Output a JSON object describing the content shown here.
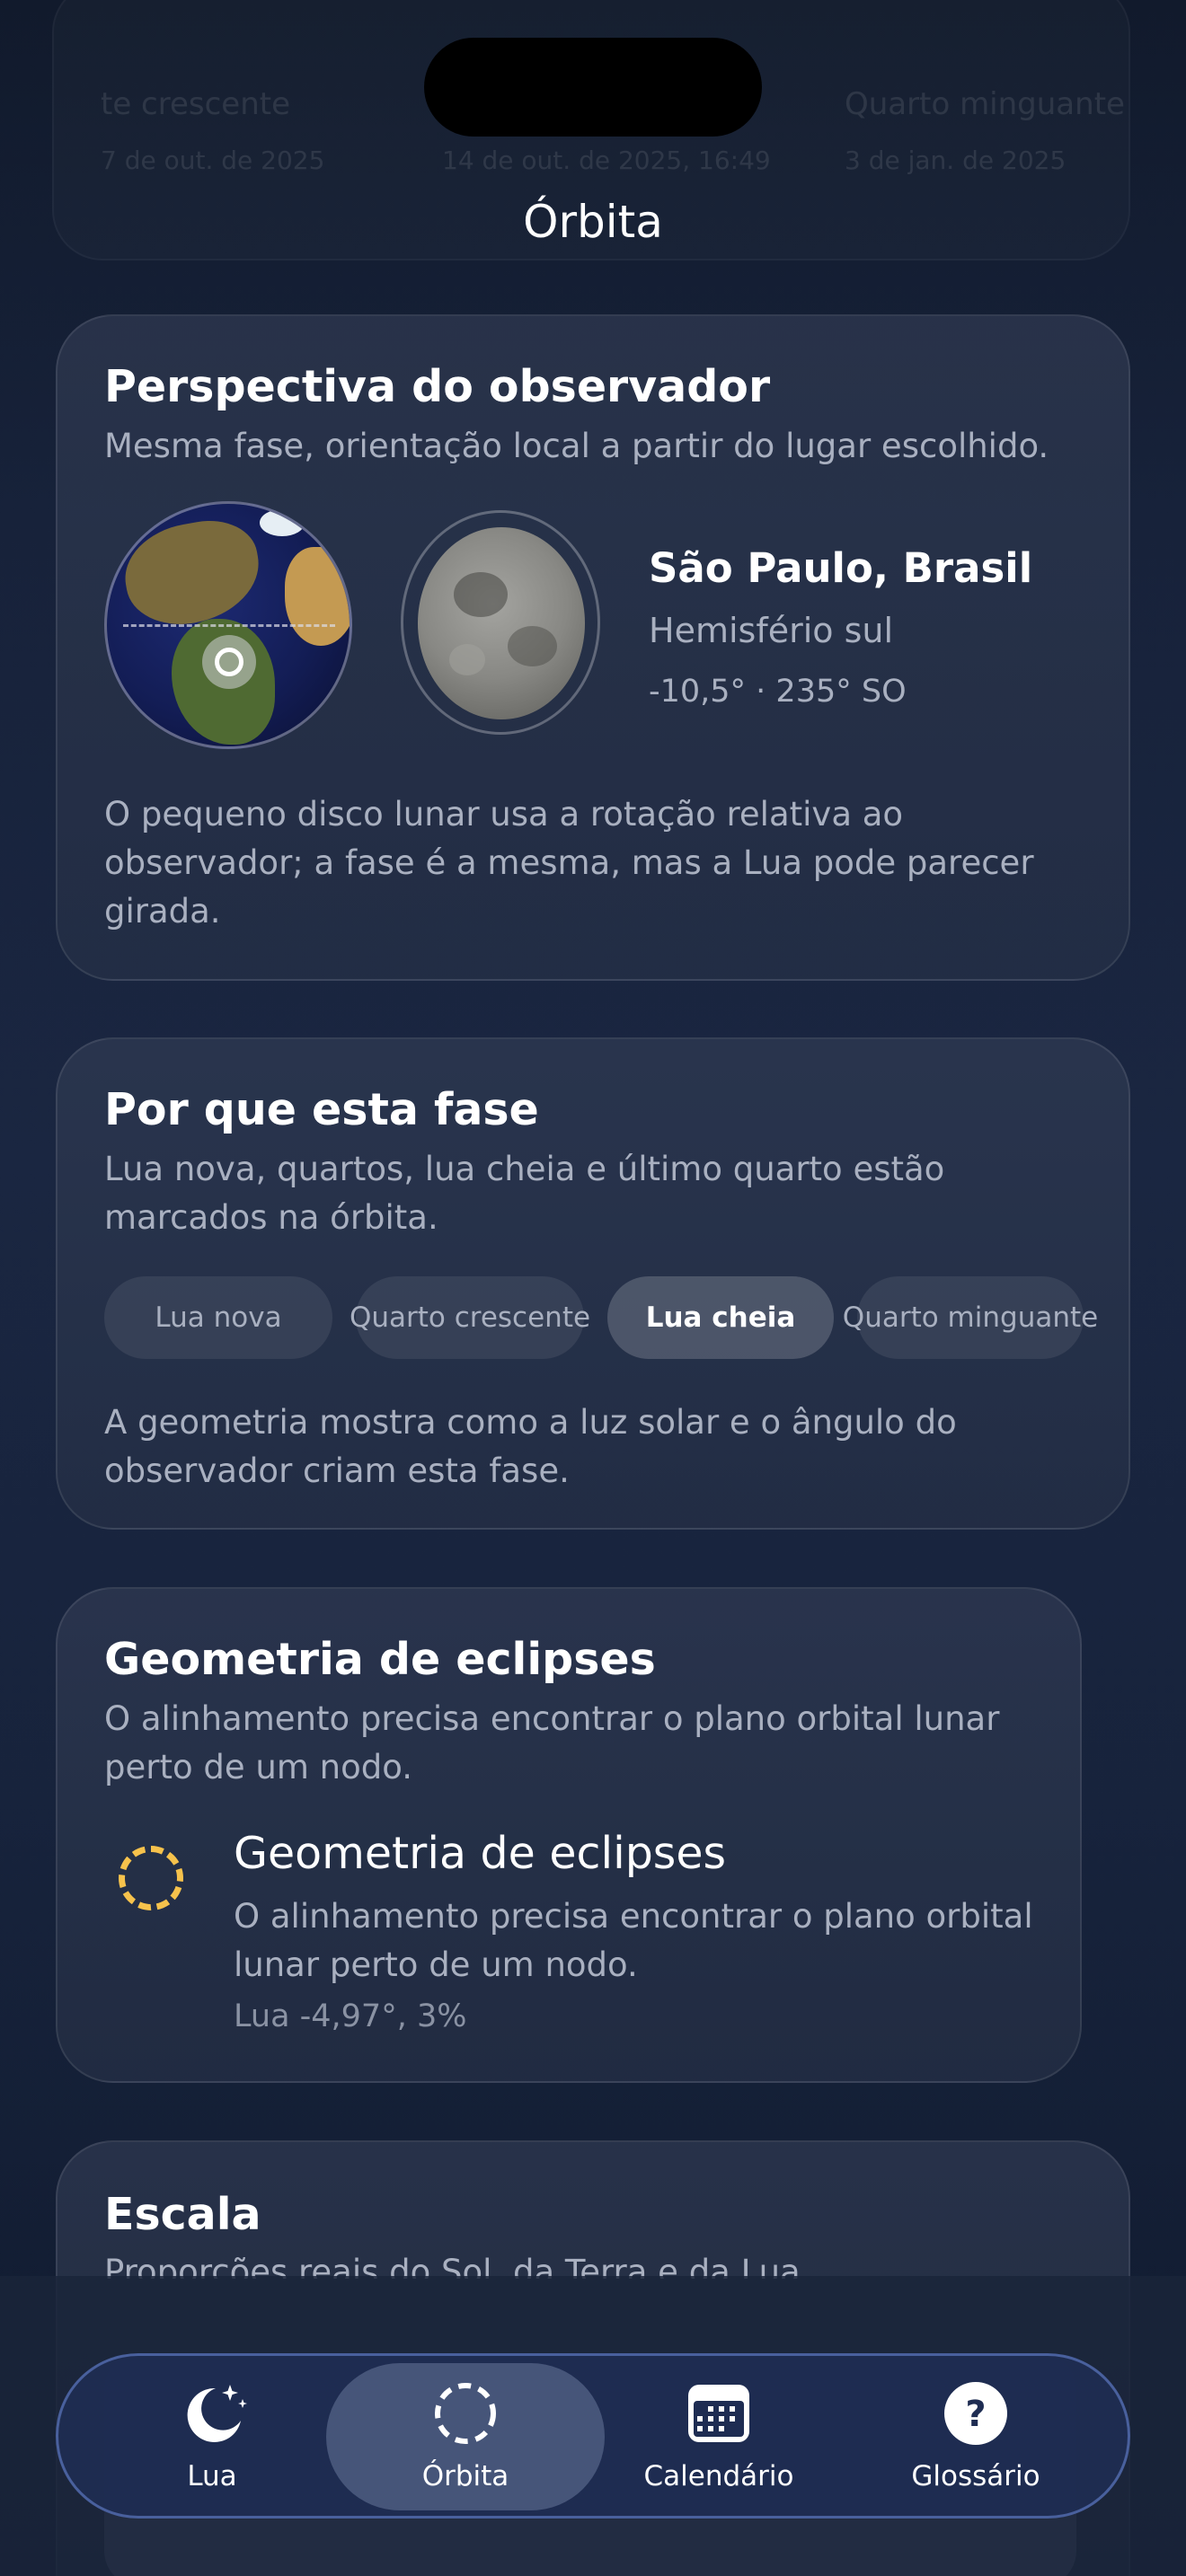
{
  "header": {
    "ghost_items": [
      {
        "title": "te crescente",
        "date": "7 de out. de 2025"
      },
      {
        "title": "",
        "date": "14 de out. de 2025, 16:49"
      },
      {
        "title": "Quarto minguante",
        "date": "3 de jan. de 2025"
      }
    ],
    "title": "Órbita"
  },
  "observer_card": {
    "title": "Perspectiva do observador",
    "subtitle": "Mesma fase, orientação local a partir do lugar escolhido.",
    "location": "São Paulo, Brasil",
    "hemisphere": "Hemisfério sul",
    "coords": "-10,5° · 235° SO",
    "note": "O pequeno disco lunar usa a rotação relativa ao observador; a fase é a mesma, mas a Lua pode parecer girada."
  },
  "phase_card": {
    "title": "Por que esta fase",
    "subtitle": "Lua nova, quartos, lua cheia e último quarto estão marcados na órbita.",
    "chips": [
      "Lua nova",
      "Quarto crescente",
      "Lua cheia",
      "Quarto minguante"
    ],
    "active_chip": "Lua cheia",
    "note": "A geometria mostra como a luz solar e o ângulo do observador criam esta fase."
  },
  "eclipse_card": {
    "title": "Geometria de eclipses",
    "subtitle": "O alinhamento precisa encontrar o plano orbital lunar perto de um nodo.",
    "item_title": "Geometria de eclipses",
    "item_desc": "O alinhamento precisa encontrar o plano orbital lunar perto de um nodo.",
    "item_value": "Lua -4,97°, 3%",
    "icon_color": "#f6c24c"
  },
  "scale_card": {
    "title": "Escala",
    "subtitle": "Proporções reais do Sol, da Terra e da Lua"
  },
  "tabbar": {
    "tabs": [
      {
        "label": "Lua",
        "icon": "moon-stars-icon"
      },
      {
        "label": "Órbita",
        "icon": "orbit-dashed-circle-icon"
      },
      {
        "label": "Calendário",
        "icon": "calendar-icon"
      },
      {
        "label": "Glossário",
        "icon": "question-circle-icon"
      }
    ],
    "active": "Órbita"
  }
}
